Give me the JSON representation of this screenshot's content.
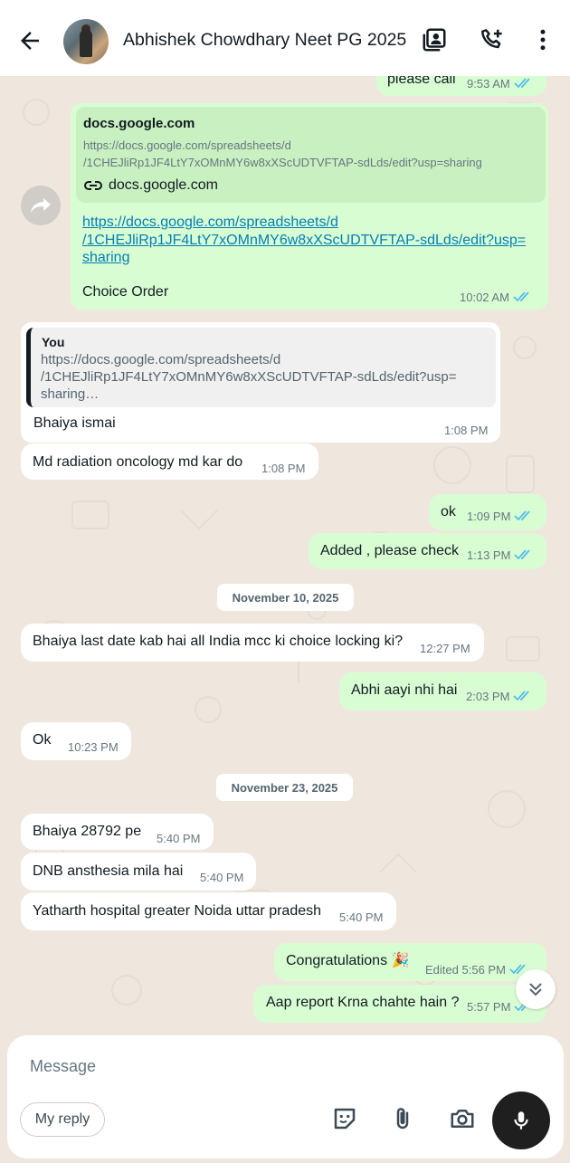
{
  "header": {
    "title": "Abhishek Chowdhary Neet PG 2025",
    "icons": [
      "back-arrow-icon",
      "contact-card-icon",
      "add-call-icon",
      "more-vert-icon"
    ]
  },
  "messages": {
    "m0": {
      "text": "please call",
      "time": "9:53 AM"
    },
    "m1": {
      "preview_title": "docs.google.com",
      "preview_url_1": "https://docs.google.com/spreadsheets/d",
      "preview_url_2": "/1CHEJliRp1JF4LtY7xOMnMY6w8xXScUDTVFTAP-sdLds/edit?usp=sharing",
      "preview_domain": "docs.google.com",
      "link_1": "https://docs.google.com/spreadsheets/d",
      "link_2": "/1CHEJliRp1JF4LtY7xOMnMY6w8xXScUDTVFTAP-sdLds/edit?usp=",
      "link_3": "sharing",
      "text": "Choice Order",
      "time": "10:02 AM"
    },
    "m2": {
      "quote_author": "You",
      "quote_1": "https://docs.google.com/spreadsheets/d",
      "quote_2": "/1CHEJliRp1JF4LtY7xOMnMY6w8xXScUDTVFTAP-sdLds/edit?usp=",
      "quote_3": "sharing…",
      "text": "Bhaiya ismai",
      "time": "1:08 PM"
    },
    "m3": {
      "text": "Md radiation oncology md kar do",
      "time": "1:08 PM"
    },
    "m4": {
      "text": "ok",
      "time": "1:09 PM"
    },
    "m5": {
      "text": "Added , please check",
      "time": "1:13 PM"
    },
    "date1": "November 10, 2025",
    "m6": {
      "text": "Bhaiya last date kab hai all India mcc ki choice locking ki?",
      "time": "12:27 PM"
    },
    "m7": {
      "text": "Abhi aayi nhi hai",
      "time": "2:03 PM"
    },
    "m8": {
      "text": "Ok",
      "time": "10:23 PM"
    },
    "date2": "November 23, 2025",
    "m9": {
      "text": "Bhaiya 28792 pe",
      "time": "5:40 PM"
    },
    "m10": {
      "text": "DNB ansthesia mila hai",
      "time": "5:40 PM"
    },
    "m11": {
      "text": "Yatharth hospital greater Noida uttar pradesh",
      "time": "5:40 PM"
    },
    "m12": {
      "text": "Congratulations 🎉",
      "edited": "Edited",
      "time": "5:56 PM"
    },
    "m13": {
      "text": "Aap report Krna chahte hain ?",
      "time": "5:57 PM"
    }
  },
  "composer": {
    "placeholder": "Message",
    "my_reply": "My reply",
    "icons": [
      "sticker-icon",
      "attach-icon",
      "camera-icon",
      "mic-icon"
    ]
  },
  "colors": {
    "outgoing_bubble": "#d9fdd3",
    "incoming_bubble": "#ffffff",
    "chat_background": "#efe7de",
    "read_ticks": "#53bdeb",
    "link": "#027eb5"
  }
}
